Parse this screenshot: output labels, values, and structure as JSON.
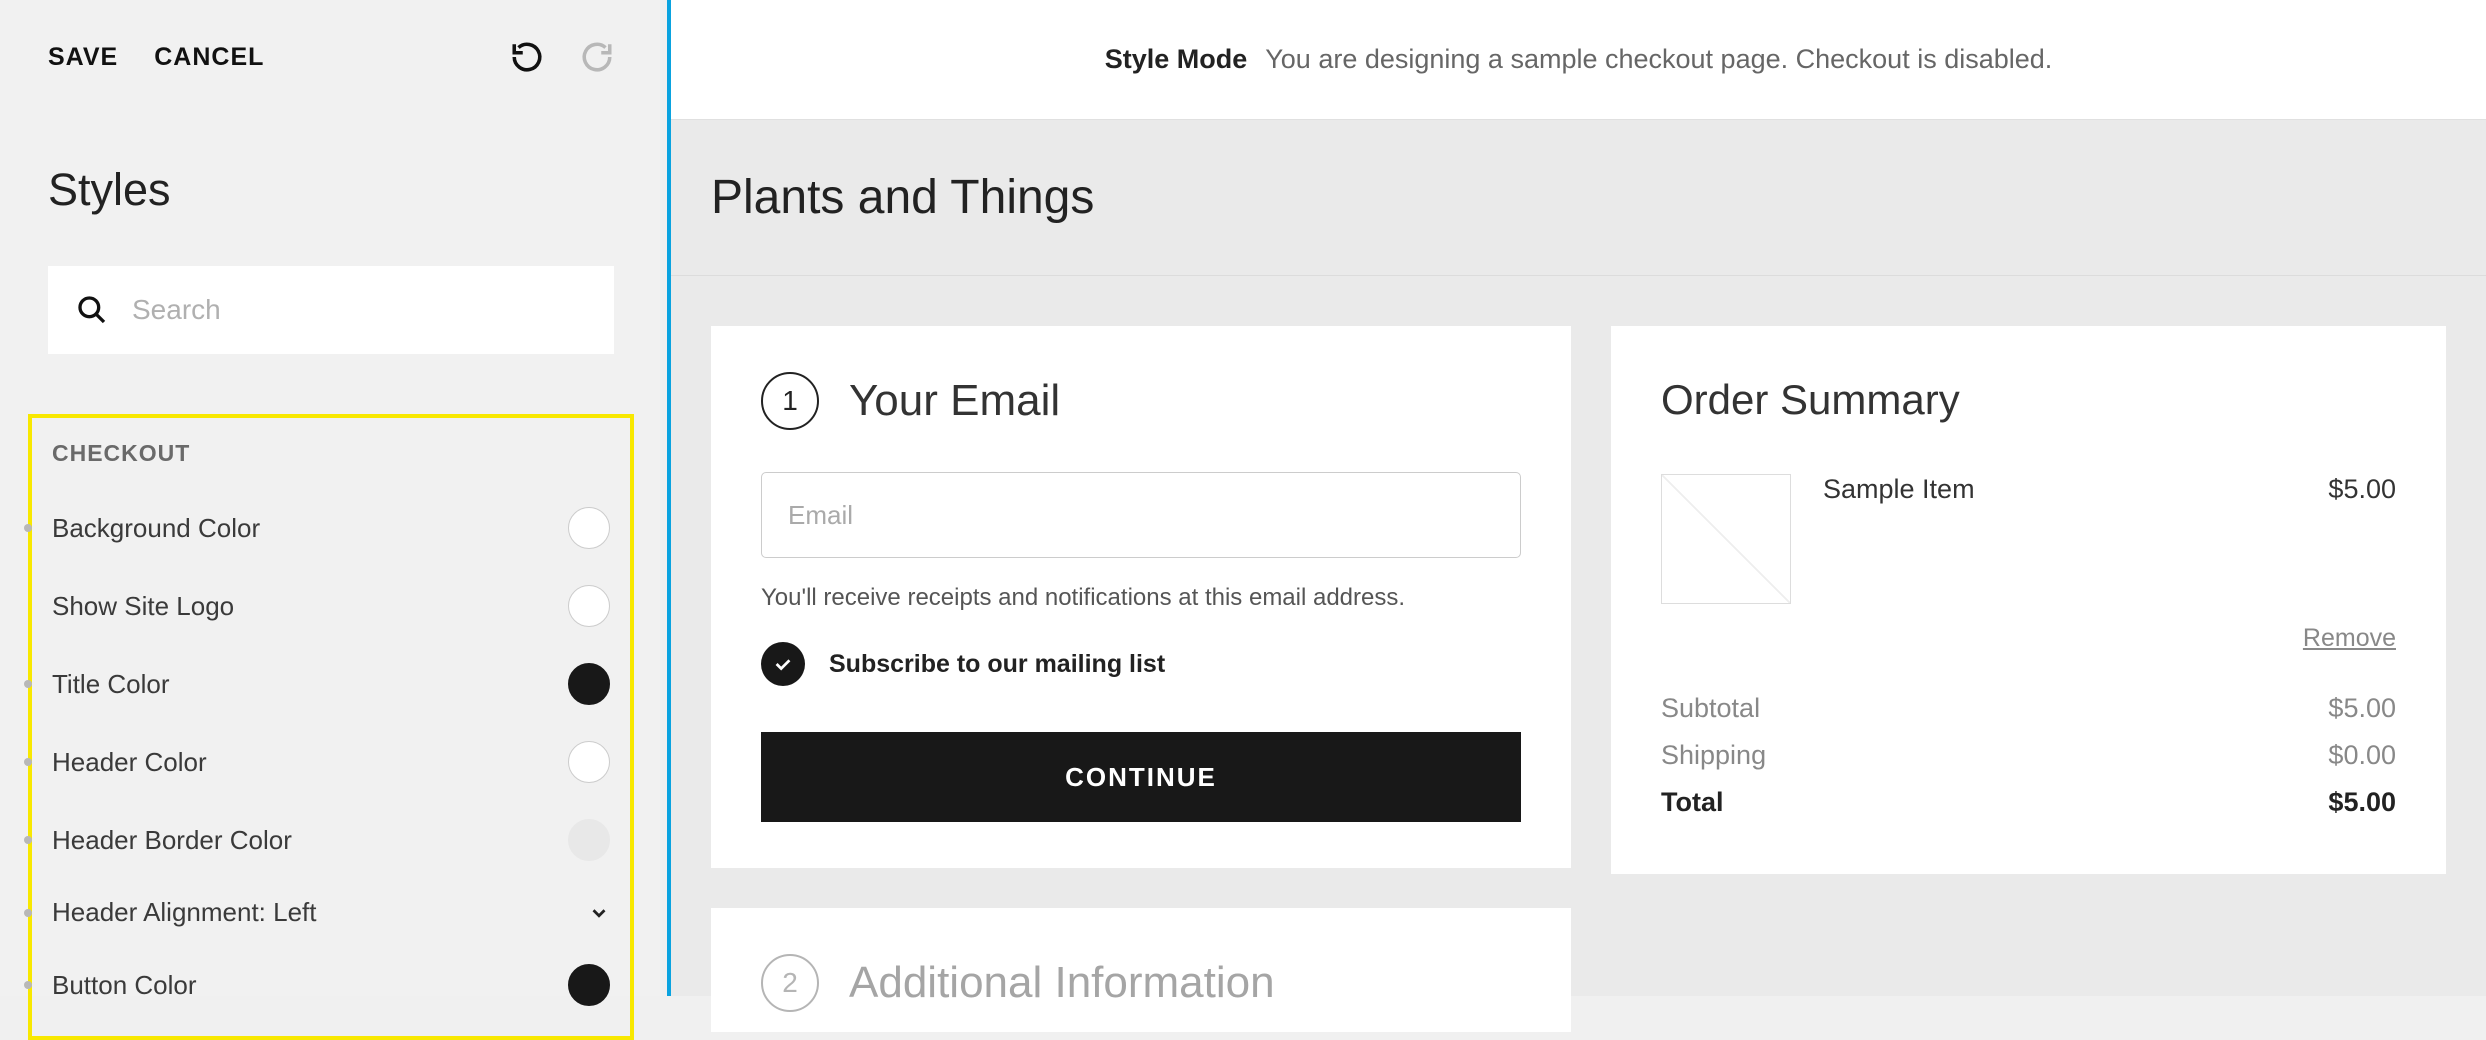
{
  "toolbar": {
    "save": "SAVE",
    "cancel": "CANCEL"
  },
  "panel": {
    "title": "Styles",
    "search_placeholder": "Search",
    "group_label": "CHECKOUT",
    "rows": {
      "background_color": "Background Color",
      "show_site_logo": "Show Site Logo",
      "title_color": "Title Color",
      "header_color": "Header Color",
      "header_border_color": "Header Border Color",
      "header_alignment": "Header Alignment: Left",
      "button_color": "Button Color"
    }
  },
  "banner": {
    "mode": "Style Mode",
    "desc": "You are designing a sample checkout page. Checkout is disabled."
  },
  "site": {
    "title": "Plants and Things"
  },
  "email_card": {
    "step": "1",
    "title": "Your Email",
    "placeholder": "Email",
    "hint": "You'll receive receipts and notifications at this email address.",
    "subscribe": "Subscribe to our mailing list",
    "continue": "CONTINUE"
  },
  "additional_card": {
    "step": "2",
    "title": "Additional Information"
  },
  "summary": {
    "title": "Order Summary",
    "item_name": "Sample Item",
    "item_price": "$5.00",
    "remove": "Remove",
    "subtotal_label": "Subtotal",
    "subtotal_value": "$5.00",
    "shipping_label": "Shipping",
    "shipping_value": "$0.00",
    "total_label": "Total",
    "total_value": "$5.00"
  }
}
